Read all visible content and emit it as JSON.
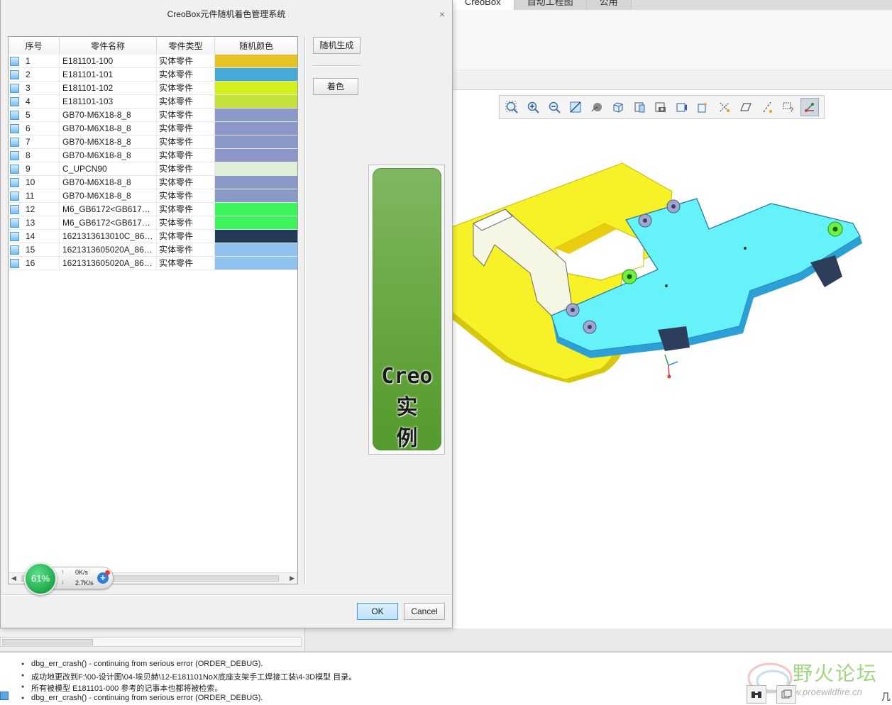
{
  "ribbon": {
    "tabs": [
      {
        "label": "CreoBox",
        "active": true
      },
      {
        "label": "自动工程图",
        "active": false
      },
      {
        "label": "公用",
        "active": false
      }
    ]
  },
  "dialog": {
    "title": "CreoBox元件随机着色管理系统",
    "close_glyph": "×",
    "columns": [
      "序号",
      "零件名称",
      "零件类型",
      "随机颜色"
    ],
    "rows": [
      {
        "index": "1",
        "name": "E181101-100",
        "type": "实体零件",
        "color": "#e5c322"
      },
      {
        "index": "2",
        "name": "E181101-101",
        "type": "实体零件",
        "color": "#45aad8"
      },
      {
        "index": "3",
        "name": "E181101-102",
        "type": "实体零件",
        "color": "#d4f01c"
      },
      {
        "index": "4",
        "name": "E181101-103",
        "type": "实体零件",
        "color": "#c4e23a"
      },
      {
        "index": "5",
        "name": "GB70-M6X18-8_8",
        "type": "实体零件",
        "color": "#8b97c7"
      },
      {
        "index": "6",
        "name": "GB70-M6X18-8_8",
        "type": "实体零件",
        "color": "#8b97c7"
      },
      {
        "index": "7",
        "name": "GB70-M6X18-8_8",
        "type": "实体零件",
        "color": "#8b97c7"
      },
      {
        "index": "8",
        "name": "GB70-M6X18-8_8",
        "type": "实体零件",
        "color": "#8b97c7"
      },
      {
        "index": "9",
        "name": "C_UPCN90",
        "type": "实体零件",
        "color": "#dff0d4"
      },
      {
        "index": "10",
        "name": "GB70-M6X18-8_8",
        "type": "实体零件",
        "color": "#8b97c7"
      },
      {
        "index": "11",
        "name": "GB70-M6X18-8_8",
        "type": "实体零件",
        "color": "#8b97c7"
      },
      {
        "index": "12",
        "name": "M6_GB6172<GB617…",
        "type": "实体零件",
        "color": "#3df55a"
      },
      {
        "index": "13",
        "name": "M6_GB6172<GB617…",
        "type": "实体零件",
        "color": "#3df55a"
      },
      {
        "index": "14",
        "name": "1621313613010C_86…",
        "type": "实体零件",
        "color": "#233a57"
      },
      {
        "index": "15",
        "name": "1621313605020A_86…",
        "type": "实体零件",
        "color": "#8fc2ef"
      },
      {
        "index": "16",
        "name": "1621313605020A_86…",
        "type": "实体零件",
        "color": "#8fc2ef"
      }
    ],
    "buttons": {
      "random_generate": "随机生成",
      "apply_color": "着色",
      "ok": "OK",
      "cancel": "Cancel"
    },
    "banner": {
      "line1": "Creo",
      "line2": "实",
      "line3": "例"
    }
  },
  "network_widget": {
    "percent": "61%",
    "upload": "0K/s",
    "download": "2.7K/s",
    "plus": "+"
  },
  "messages": [
    "dbg_err_crash() - continuing from serious error (ORDER_DEBUG).",
    "成功地更改到F:\\00-设计图\\04-埃贝赫\\12-E181101NoX底座支架手工焊接工装\\4-3D模型 目录。",
    "所有被模型 E181101-000 参考的记事本也都将被检索。",
    "dbg_err_crash() - continuing from serious error (ORDER_DEBUG)."
  ],
  "watermark": {
    "text": "野火论坛",
    "url": "www.proewildfire.cn"
  },
  "corner_text": "几",
  "icons": {
    "view_toolbar": [
      "zoom-fit-icon",
      "zoom-in-icon",
      "zoom-out-icon",
      "repaint-icon",
      "spin-center-icon",
      "saved-views-icon",
      "display-style-icon",
      "perspective-icon",
      "camera-icon",
      "datum-display-icon",
      "annotation-display-icon",
      "plane-display-icon",
      "axis-display-icon",
      "point-display-icon",
      "csys-display-icon",
      "spin-pivot-icon"
    ]
  }
}
